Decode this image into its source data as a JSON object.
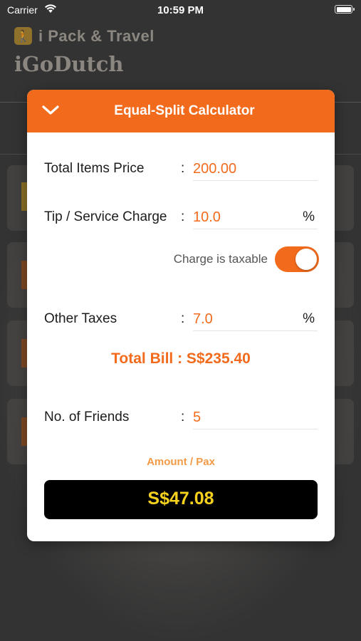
{
  "status_bar": {
    "carrier": "Carrier",
    "time": "10:59 PM",
    "battery_level": 1.0
  },
  "app": {
    "brand": "i Pack & Travel",
    "title": "iGoDutch",
    "brand_icon": "walking-person-icon"
  },
  "modal": {
    "title": "Equal-Split Calculator",
    "collapse_icon": "chevron-down-icon",
    "fields": {
      "total_items_price": {
        "label": "Total Items Price",
        "colon": ":",
        "value": "200.00"
      },
      "tip_service_charge": {
        "label": "Tip / Service Charge",
        "colon": ":",
        "value": "10.0",
        "unit": "%"
      },
      "other_taxes": {
        "label": "Other Taxes",
        "colon": ":",
        "value": "7.0",
        "unit": "%"
      },
      "no_of_friends": {
        "label": "No. of Friends",
        "colon": ":",
        "value": "5"
      }
    },
    "charge_taxable": {
      "label": "Charge is taxable",
      "on": true
    },
    "total_bill": "Total Bill : S$235.40",
    "amount_label": "Amount / Pax",
    "amount_value": "S$47.08"
  },
  "colors": {
    "accent": "#f26b1d",
    "amount_text": "#f6d21e",
    "amount_bg": "#000000"
  }
}
